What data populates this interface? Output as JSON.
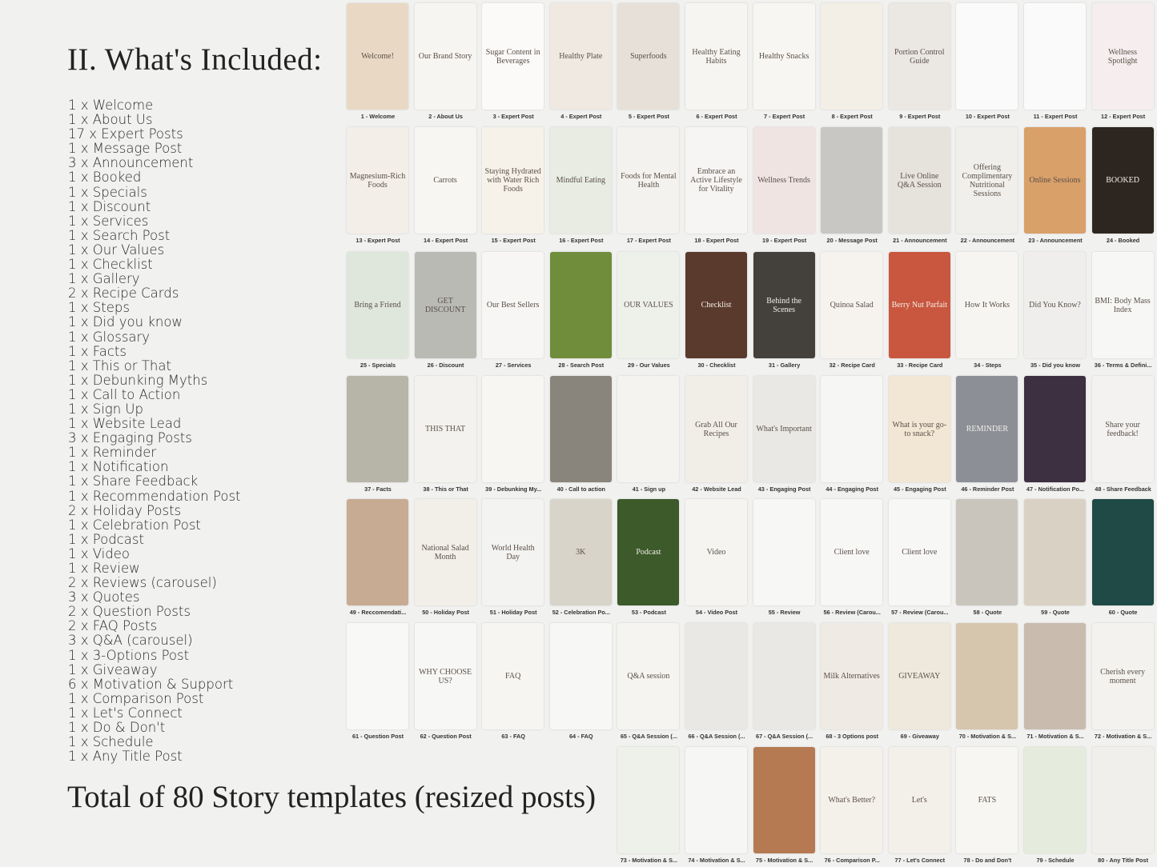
{
  "heading": "II. What's Included:",
  "included": [
    "1 x Welcome",
    "1 x About Us",
    "17 x Expert Posts",
    "1 x Message Post",
    "3 x Announcement",
    "1 x Booked",
    "1 x Specials",
    "1 x Discount",
    "1 x Services",
    "1 x Search Post",
    "1 x Our Values",
    "1 x Checklist",
    "1 x Gallery",
    "2 x Recipe Cards",
    "1 x Steps",
    "1 x Did you know",
    "1 x Glossary",
    "1 x Facts",
    "1 x This or That",
    "1 x Debunking Myths",
    "1 x Call to Action",
    "1 x Sign Up",
    "1 x Website Lead",
    "3 x Engaging Posts",
    "1 x Reminder",
    "1 x Notification",
    "1 x Share Feedback",
    "1 x Recommendation Post",
    "2 x Holiday Posts",
    "1 x Celebration Post",
    "1 x Podcast",
    "1 x Video",
    "1 x Review",
    "2 x Reviews (carousel)",
    "3 x Quotes",
    "2 x Question Posts",
    "2 x FAQ Posts",
    "3 x Q&A (carousel)",
    "1 x 3-Options Post",
    "1 x Giveaway",
    "6 x Motivation & Support",
    "1 x Comparison Post",
    "1 x Let's Connect",
    "1 x Do & Don't",
    "1 x Schedule",
    "1 x Any Title Post"
  ],
  "total": "Total of  80 Story templates (resized posts)",
  "templates": [
    {
      "caption": "1 - Welcome",
      "color": "#e9d9c4",
      "title": "Welcome!"
    },
    {
      "caption": "2 - About Us",
      "color": "#f7f5f2",
      "title": "Our Brand Story"
    },
    {
      "caption": "3 - Expert Post",
      "color": "#fbfaf8",
      "title": "Sugar Content in Beverages"
    },
    {
      "caption": "4 - Expert Post",
      "color": "#efe9e2",
      "title": "Healthy Plate"
    },
    {
      "caption": "5 - Expert Post",
      "color": "#e6e0d8",
      "title": "Superfoods"
    },
    {
      "caption": "6 - Expert Post",
      "color": "#f7f5f1",
      "title": "Healthy Eating Habits"
    },
    {
      "caption": "7 - Expert Post",
      "color": "#f8f6f2",
      "title": "Healthy Snacks"
    },
    {
      "caption": "8 - Expert Post",
      "color": "#f4efe6",
      "title": ""
    },
    {
      "caption": "9 - Expert Post",
      "color": "#ebe7e2",
      "title": "Portion Control Guide"
    },
    {
      "caption": "10 - Expert Post",
      "color": "#fafafa",
      "title": ""
    },
    {
      "caption": "11 - Expert Post",
      "color": "#fafafa",
      "title": ""
    },
    {
      "caption": "12 - Expert Post",
      "color": "#f6eeee",
      "title": "Wellness Spotlight"
    },
    {
      "caption": "13 - Expert Post",
      "color": "#f3eee8",
      "title": "Magnesium-Rich Foods"
    },
    {
      "caption": "14 - Expert Post",
      "color": "#f8f6f2",
      "title": "Carrots"
    },
    {
      "caption": "15 - Expert Post",
      "color": "#f6f2ea",
      "title": "Staying Hydrated with Water Rich Foods"
    },
    {
      "caption": "16 - Expert Post",
      "color": "#e8ece2",
      "title": "Mindful Eating"
    },
    {
      "caption": "17 - Expert Post",
      "color": "#f4f2ee",
      "title": "Foods for Mental Health"
    },
    {
      "caption": "18 - Expert Post",
      "color": "#f6f5f3",
      "title": "Embrace an Active Lifestyle for Vitality"
    },
    {
      "caption": "19 - Expert Post",
      "color": "#efe4e2",
      "title": "Wellness Trends"
    },
    {
      "caption": "20 - Message Post",
      "color": "#c9c7c4",
      "title": ""
    },
    {
      "caption": "21 - Announcement",
      "color": "#e6e3dc",
      "title": "Live Online Q&A Session"
    },
    {
      "caption": "22 - Announcement",
      "color": "#f1efeb",
      "title": "Offering Complimentary Nutritional Sessions"
    },
    {
      "caption": "23 - Announcement",
      "color": "#d9a06a",
      "title": "Online Sessions"
    },
    {
      "caption": "24 - Booked",
      "color": "#2d2620",
      "title": "BOOKED"
    },
    {
      "caption": "25 - Specials",
      "color": "#dfe6dc",
      "title": "Bring a Friend"
    },
    {
      "caption": "26 - Discount",
      "color": "#b9bab4",
      "title": "GET DISCOUNT"
    },
    {
      "caption": "27 - Services",
      "color": "#f7f6f4",
      "title": "Our Best Sellers"
    },
    {
      "caption": "28 - Search Post",
      "color": "#6f8d3a",
      "title": ""
    },
    {
      "caption": "29 - Our Values",
      "color": "#eef0ea",
      "title": "OUR VALUES"
    },
    {
      "caption": "30 - Checklist",
      "color": "#5a3a2c",
      "title": "Checklist"
    },
    {
      "caption": "31 - Gallery",
      "color": "#44413d",
      "title": "Behind the Scenes"
    },
    {
      "caption": "32 - Recipe Card",
      "color": "#f6f3ee",
      "title": "Quinoa Salad"
    },
    {
      "caption": "33 - Recipe Card",
      "color": "#c9573f",
      "title": "Berry Nut Parfait"
    },
    {
      "caption": "34 - Steps",
      "color": "#f6f5f2",
      "title": "How It Works"
    },
    {
      "caption": "35 - Did you know",
      "color": "#efeeec",
      "title": "Did You Know?"
    },
    {
      "caption": "36 - Terms & Defini...",
      "color": "#f7f7f6",
      "title": "BMI: Body Mass Index"
    },
    {
      "caption": "37 - Facts",
      "color": "#b7b5a8",
      "title": ""
    },
    {
      "caption": "38 - This or That",
      "color": "#f3f2ee",
      "title": "THIS THAT"
    },
    {
      "caption": "39 - Debunking My...",
      "color": "#f7f6f3",
      "title": ""
    },
    {
      "caption": "40 - Call to action",
      "color": "#8a857c",
      "title": ""
    },
    {
      "caption": "41 - Sign up",
      "color": "#f5f3ef",
      "title": ""
    },
    {
      "caption": "42 - Website Lead",
      "color": "#f1eee8",
      "title": "Grab All Our Recipes"
    },
    {
      "caption": "43 - Engaging Post",
      "color": "#e9e8e4",
      "title": "What's Important"
    },
    {
      "caption": "44 - Engaging Post",
      "color": "#f6f6f5",
      "title": ""
    },
    {
      "caption": "45 - Engaging Post",
      "color": "#f2e6d4",
      "title": "What is your go-to snack?"
    },
    {
      "caption": "46 - Reminder Post",
      "color": "#8c8f96",
      "title": "REMINDER"
    },
    {
      "caption": "47 - Notification Po...",
      "color": "#3d3040",
      "title": ""
    },
    {
      "caption": "48 - Share Feedback",
      "color": "#f3f2f0",
      "title": "Share your feedback!"
    },
    {
      "caption": "49 - Reccomendati...",
      "color": "#c8ab93",
      "title": ""
    },
    {
      "caption": "50 - Holiday Post",
      "color": "#f2efe8",
      "title": "National Salad Month"
    },
    {
      "caption": "51 - Holiday Post",
      "color": "#f3f3f1",
      "title": "World Health Day"
    },
    {
      "caption": "52 - Celebration Po...",
      "color": "#d8d4ca",
      "title": "3K"
    },
    {
      "caption": "53 - Podcast",
      "color": "#3c5a2a",
      "title": "Podcast"
    },
    {
      "caption": "54 - Video Post",
      "color": "#f5f4f1",
      "title": "Video"
    },
    {
      "caption": "55 - Review",
      "color": "#f7f7f6",
      "title": ""
    },
    {
      "caption": "56 - Review (Carou...",
      "color": "#f7f7f6",
      "title": "Client love"
    },
    {
      "caption": "57 - Review (Carou...",
      "color": "#f7f7f6",
      "title": "Client love"
    },
    {
      "caption": "58 - Quote",
      "color": "#c9c5bd",
      "title": ""
    },
    {
      "caption": "59 - Quote",
      "color": "#d9d2c4",
      "title": ""
    },
    {
      "caption": "60 - Quote",
      "color": "#1f4a46",
      "title": ""
    },
    {
      "caption": "61 - Question Post",
      "color": "#f8f8f7",
      "title": ""
    },
    {
      "caption": "62 - Question Post",
      "color": "#f7f7f5",
      "title": "WHY CHOOSE US?"
    },
    {
      "caption": "63 - FAQ",
      "color": "#f6f5f2",
      "title": "FAQ"
    },
    {
      "caption": "64 - FAQ",
      "color": "#f7f7f6",
      "title": ""
    },
    {
      "caption": "65 - Q&A Session (...",
      "color": "#f5f4f1",
      "title": "Q&A session"
    },
    {
      "caption": "66 - Q&A Session (...",
      "color": "#e9e8e5",
      "title": ""
    },
    {
      "caption": "67 - Q&A Session (...",
      "color": "#e9e8e5",
      "title": ""
    },
    {
      "caption": "68 - 3 Options post",
      "color": "#efeae4",
      "title": "Milk Alternatives"
    },
    {
      "caption": "69 - Giveaway",
      "color": "#eee9dc",
      "title": "GIVEAWAY"
    },
    {
      "caption": "70 - Motivation & S...",
      "color": "#d6c6ad",
      "title": ""
    },
    {
      "caption": "71 - Motivation & S...",
      "color": "#c9bbae",
      "title": ""
    },
    {
      "caption": "72 - Motivation & S...",
      "color": "#f3f2ef",
      "title": "Cherish every moment"
    },
    {
      "caption": "73 - Motivation & S...",
      "color": "#eef0ea",
      "title": ""
    },
    {
      "caption": "74 - Motivation & S...",
      "color": "#f6f6f4",
      "title": ""
    },
    {
      "caption": "75 - Motivation & S...",
      "color": "#b57a52",
      "title": ""
    },
    {
      "caption": "76 - Comparison P...",
      "color": "#f4f1ea",
      "title": "What's Better?"
    },
    {
      "caption": "77 - Let's Connect",
      "color": "#f3efe9",
      "title": "Let's"
    },
    {
      "caption": "78 - Do and Don't",
      "color": "#f7f6f3",
      "title": "FATS"
    },
    {
      "caption": "79 - Schedule",
      "color": "#e5ebdd",
      "title": ""
    },
    {
      "caption": "80 - Any Title Post",
      "color": "#f1efec",
      "title": ""
    }
  ]
}
